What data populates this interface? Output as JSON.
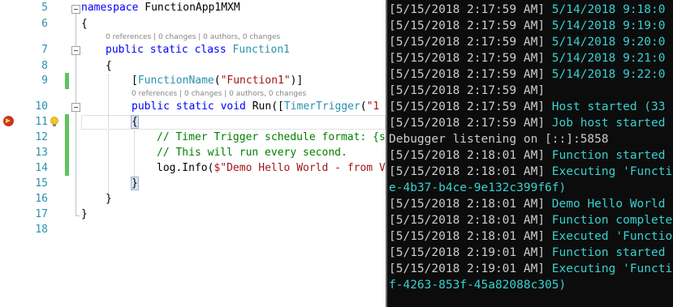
{
  "editor": {
    "line_numbers": [
      "5",
      "6",
      "7",
      "8",
      "9",
      "10",
      "11",
      "12",
      "13",
      "14",
      "15",
      "16",
      "17",
      "18"
    ],
    "lines": {
      "l5_kw": "namespace",
      "l5_name": " FunctionApp1MXM",
      "l6": "{",
      "l7_kw": "public static class",
      "l7_name": " Function1",
      "l8": "{",
      "l9_open": "[",
      "l9_attr": "FunctionName",
      "l9_paren": "(",
      "l9_str": "\"Function1\"",
      "l9_close": ")]",
      "l10_kw": "public static void",
      "l10_run": " Run([",
      "l10_type": "TimerTrigger",
      "l10_paren": "(",
      "l10_str": "\"1 *",
      "l11": "{",
      "l12": "// Timer Trigger schedule format: {se",
      "l13": "// This will run every second.",
      "l14_call": "log.Info(",
      "l14_str": "$\"Demo Hello World - from Vi",
      "l15": "}",
      "l16": "}",
      "l17": "}"
    },
    "codelens_class": "0 references | 0 changes | 0 authors, 0 changes",
    "codelens_method": "0 references | 0 changes | 0 authors, 0 changes",
    "breakpoint_icon": "breakpoint-current-statement-icon",
    "lightbulb_icon": "lightbulb-icon"
  },
  "console": {
    "lines": [
      {
        "ts": "[5/15/2018 2:17:59 AM]",
        "msg": " 5/14/2018 9:18:0"
      },
      {
        "ts": "[5/15/2018 2:17:59 AM]",
        "msg": " 5/14/2018 9:19:0"
      },
      {
        "ts": "[5/15/2018 2:17:59 AM]",
        "msg": " 5/14/2018 9:20:0"
      },
      {
        "ts": "[5/15/2018 2:17:59 AM]",
        "msg": " 5/14/2018 9:21:0"
      },
      {
        "ts": "[5/15/2018 2:17:59 AM]",
        "msg": " 5/14/2018 9:22:0"
      },
      {
        "ts": "[5/15/2018 2:17:59 AM]",
        "msg": ""
      },
      {
        "ts": "[5/15/2018 2:17:59 AM]",
        "msg": " Host started (33"
      },
      {
        "ts": "[5/15/2018 2:17:59 AM]",
        "msg": " Job host started"
      },
      {
        "ts": "Debugger listening on [::]:5858",
        "msg": ""
      },
      {
        "ts": "[5/15/2018 2:18:01 AM]",
        "msg": " Function started"
      },
      {
        "ts": "[5/15/2018 2:18:01 AM]",
        "msg": " Executing 'Functi"
      },
      {
        "ts": "",
        "msg": "e-4b37-b4ce-9e132c399f6f)"
      },
      {
        "ts": "[5/15/2018 2:18:01 AM]",
        "msg": " Demo Hello World"
      },
      {
        "ts": "[5/15/2018 2:18:01 AM]",
        "msg": " Function complete"
      },
      {
        "ts": "[5/15/2018 2:18:01 AM]",
        "msg": " Executed 'Functio"
      },
      {
        "ts": "[5/15/2018 2:19:01 AM]",
        "msg": " Function started"
      },
      {
        "ts": "[5/15/2018 2:19:01 AM]",
        "msg": " Executing 'Functi"
      },
      {
        "ts": "",
        "msg": "f-4263-853f-45a82088c305)"
      }
    ]
  },
  "colors": {
    "console_bg": "#0c0c0c",
    "console_timestamp": "#cccccc",
    "console_message": "#3ad0d0",
    "keyword": "#0000ff",
    "type": "#2b91af",
    "string": "#a31515",
    "comment": "#008000",
    "changed_line_marker": "#5cc65c",
    "breakpoint": "#c8352a"
  }
}
